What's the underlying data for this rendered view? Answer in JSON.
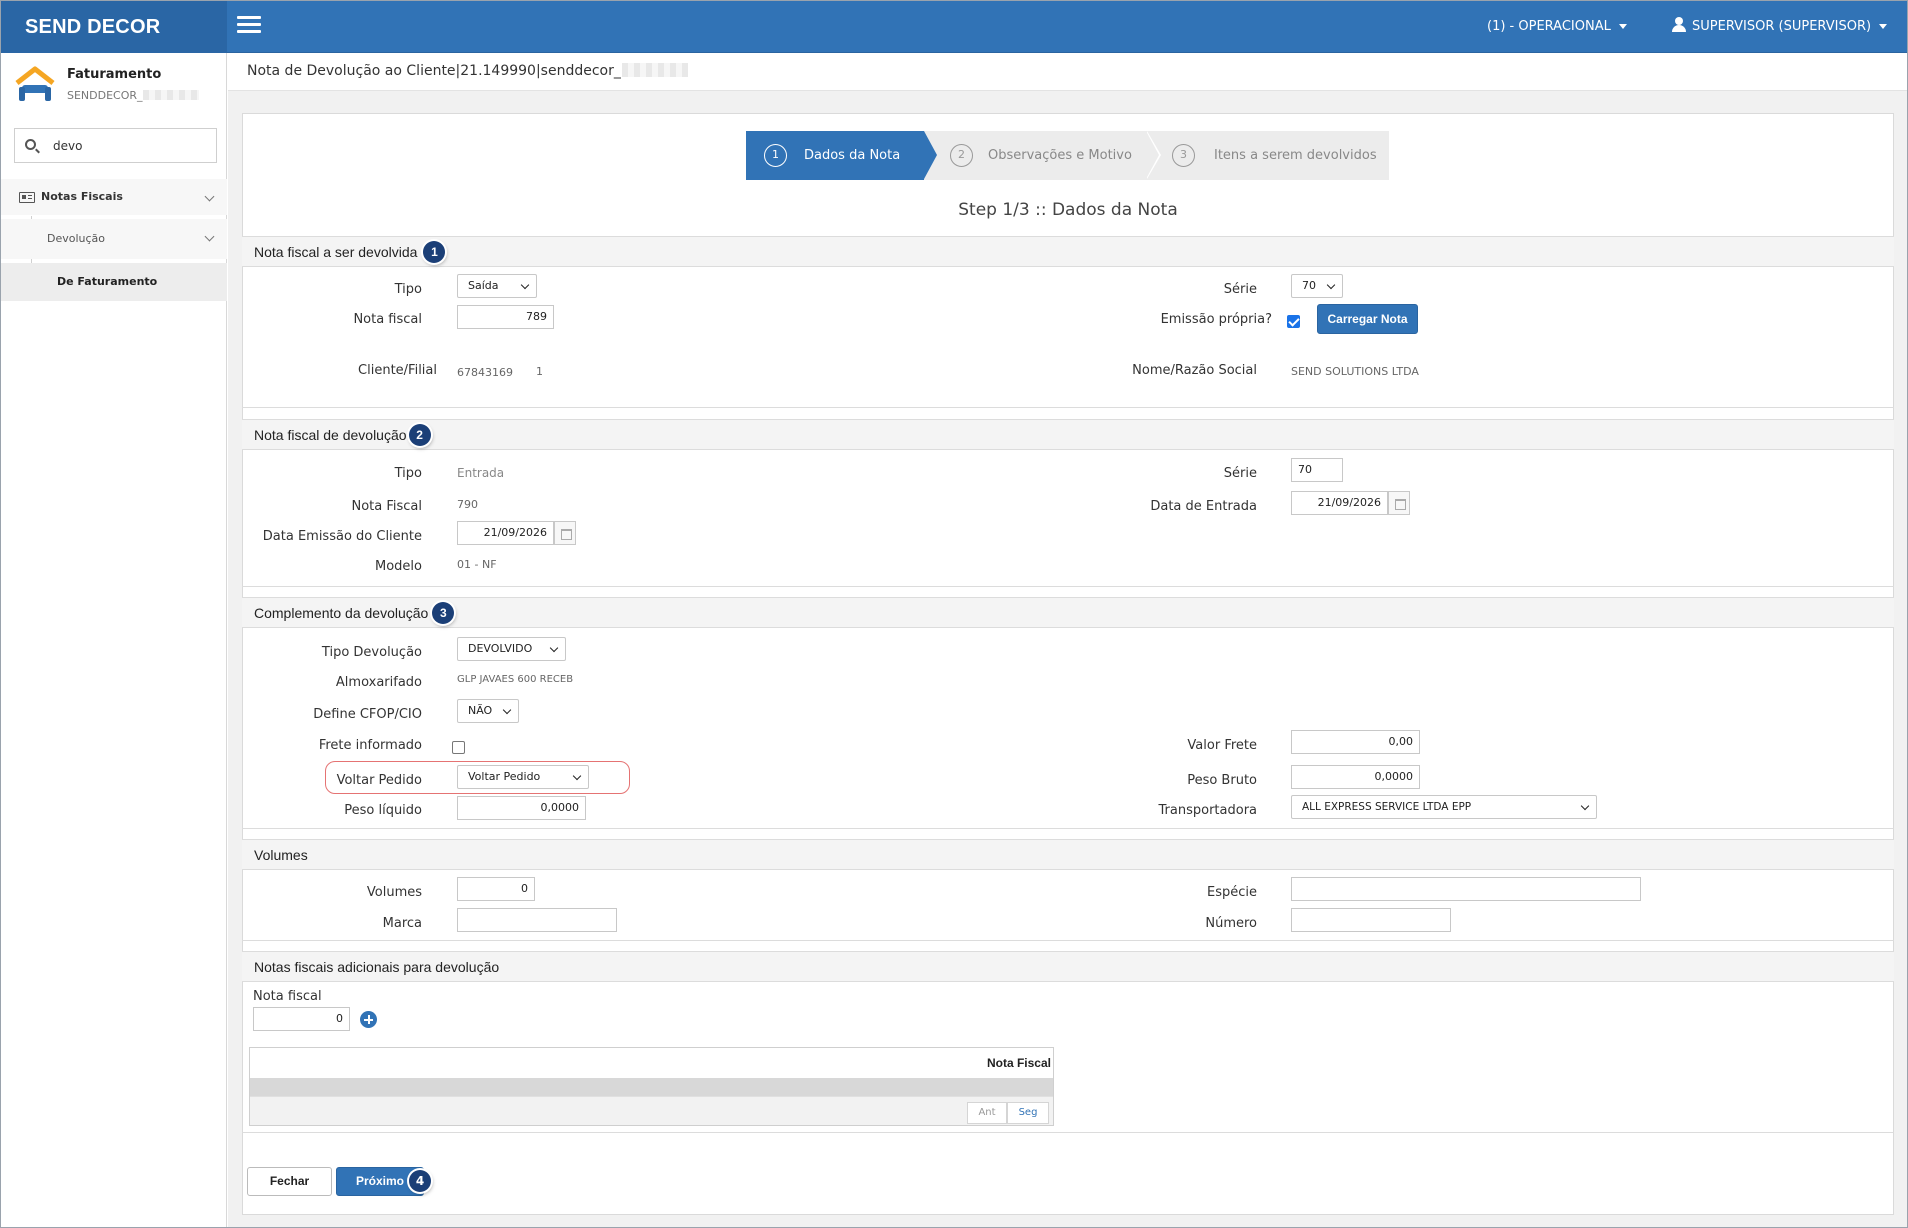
{
  "header": {
    "brand": "SEND DECOR",
    "context_menu": "(1) - OPERACIONAL",
    "user_menu": "SUPERVISOR (SUPERVISOR)"
  },
  "sidebar": {
    "module_title": "Faturamento",
    "module_sub": "SENDDECOR_",
    "search_value": "devo",
    "items": [
      {
        "label": "Notas Fiscais"
      },
      {
        "label": "Devolução"
      },
      {
        "label": "De Faturamento"
      }
    ]
  },
  "page": {
    "title": "Nota de Devolução ao Cliente|21.149990|senddecor_"
  },
  "wizard": {
    "steps": [
      {
        "num": "1",
        "label": "Dados da Nota"
      },
      {
        "num": "2",
        "label": "Observações e Motivo"
      },
      {
        "num": "3",
        "label": "Itens a serem devolvidos"
      }
    ],
    "caption": "Step 1/3 :: Dados da Nota"
  },
  "section1": {
    "title": "Nota fiscal a ser devolvida",
    "badge": "1",
    "tipo_label": "Tipo",
    "tipo_value": "Saída",
    "nota_label": "Nota fiscal",
    "nota_value": "789",
    "cliente_label": "Cliente/Filial",
    "cliente_value": "67843169",
    "filial_value": "1",
    "serie_label": "Série",
    "serie_value": "70",
    "emissao_label": "Emissão própria?",
    "carregar_label": "Carregar Nota",
    "nome_label": "Nome/Razão Social",
    "nome_value": "SEND SOLUTIONS LTDA"
  },
  "section2": {
    "title": "Nota fiscal de devolução",
    "badge": "2",
    "tipo_label": "Tipo",
    "tipo_value": "Entrada",
    "nota_label": "Nota Fiscal",
    "nota_value": "790",
    "data_emissao_label": "Data Emissão do Cliente",
    "data_emissao_value": "21/09/2026",
    "modelo_label": "Modelo",
    "modelo_value": "01 - NF",
    "serie_label": "Série",
    "serie_value": "70",
    "data_entrada_label": "Data de Entrada",
    "data_entrada_value": "21/09/2026"
  },
  "section3": {
    "title": "Complemento da devolução",
    "badge": "3",
    "tipo_dev_label": "Tipo Devolução",
    "tipo_dev_value": "DEVOLVIDO",
    "almox_label": "Almoxarifado",
    "almox_value": "GLP JAVAES 600 RECEB",
    "cfop_label": "Define CFOP/CIO",
    "cfop_value": "NÃO",
    "frete_inf_label": "Frete informado",
    "voltar_label": "Voltar Pedido",
    "voltar_value": "Voltar Pedido",
    "peso_liq_label": "Peso líquido",
    "peso_liq_value": "0,0000",
    "valor_frete_label": "Valor Frete",
    "valor_frete_value": "0,00",
    "peso_bruto_label": "Peso Bruto",
    "peso_bruto_value": "0,0000",
    "transp_label": "Transportadora",
    "transp_value": "ALL EXPRESS SERVICE LTDA EPP"
  },
  "section4": {
    "title": "Volumes",
    "volumes_label": "Volumes",
    "volumes_value": "0",
    "marca_label": "Marca",
    "marca_value": "",
    "especie_label": "Espécie",
    "especie_value": "",
    "numero_label": "Número",
    "numero_value": ""
  },
  "section5": {
    "title": "Notas fiscais adicionais para devolução",
    "nota_label": "Nota fiscal",
    "nota_value": "0",
    "table_header": "Nota Fiscal",
    "prev_label": "Ant",
    "next_label": "Seg"
  },
  "footer": {
    "fechar_label": "Fechar",
    "proximo_label": "Próximo",
    "badge": "4"
  },
  "colors": {
    "primary": "#3173b6",
    "brand_bg": "#2a66a5",
    "badge": "#1b3f77",
    "highlight": "#e57373"
  }
}
